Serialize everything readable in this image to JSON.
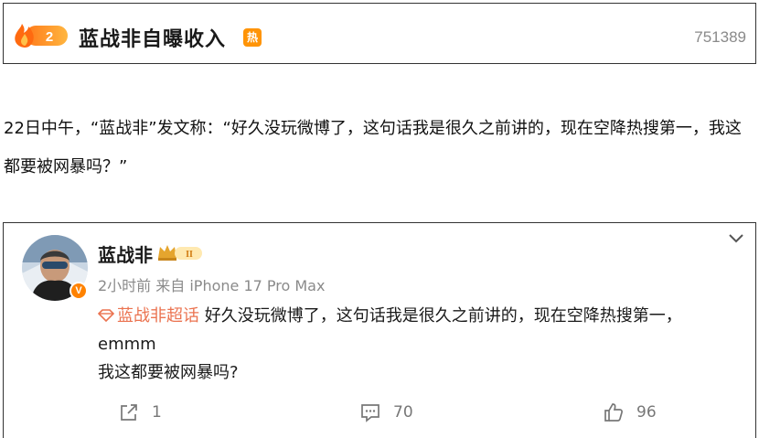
{
  "hot_search": {
    "rank": "2",
    "title": "蓝战非自曝收入",
    "tag": "热",
    "count": "751389"
  },
  "article": {
    "text": "22日中午，“蓝战非”发文称：“好久没玩微博了，这句话我是很久之前讲的，现在空降热搜第一，我这都要被网暴吗？”"
  },
  "post": {
    "username": "蓝战非",
    "level_badge": "II",
    "verified_mark": "V",
    "meta": "2小时前 来自 iPhone 17 Pro Max",
    "topic": "蓝战非超话",
    "body_line1": "好久没玩微博了，这句话我是很久之前讲的，现在空降热搜第一，",
    "body_line2": "emmm",
    "body_line3": "我这都要被网暴吗?",
    "shares": "1",
    "comments": "70",
    "likes": "96"
  },
  "colors": {
    "hot_orange": "#ff9406",
    "topic_orange": "#eb7350",
    "verified_orange": "#ff8200",
    "meta_gray": "#8a8a8a"
  },
  "icons": [
    "fire-rank-icon",
    "hot-tag",
    "crown-badge-icon",
    "chevron-down-icon",
    "diamond-topic-icon",
    "share-icon",
    "comment-icon",
    "like-icon"
  ]
}
